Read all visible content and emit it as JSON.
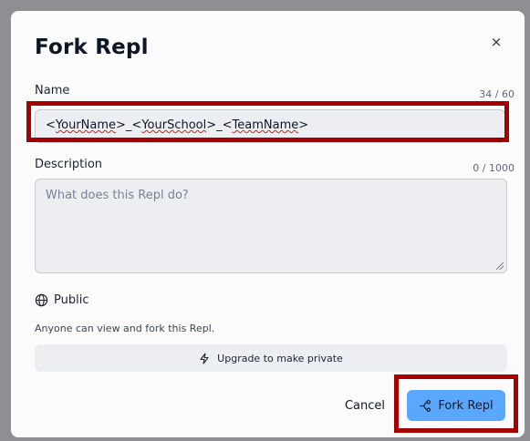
{
  "dialog": {
    "title": "Fork Repl",
    "close_icon": "×"
  },
  "name_field": {
    "label": "Name",
    "counter": "34 / 60",
    "value": "<YourName>_<YourSchool>_<TeamName>",
    "value_parts": [
      "<",
      "YourName",
      ">_<",
      "YourSchool",
      ">_<",
      "TeamName",
      ">"
    ]
  },
  "description_field": {
    "label": "Description",
    "counter": "0 / 1000",
    "placeholder": "What does this Repl do?"
  },
  "visibility": {
    "icon": "globe-icon",
    "label": "Public",
    "helper": "Anyone can view and fork this Repl.",
    "upgrade_icon": "lightning-icon",
    "upgrade_label": "Upgrade to make private"
  },
  "actions": {
    "cancel_label": "Cancel",
    "fork_icon": "fork-icon",
    "fork_label": "Fork Repl"
  },
  "colors": {
    "primary_button": "#5aa7ff",
    "highlight": "#a50000",
    "field_bg": "#eceef1"
  }
}
